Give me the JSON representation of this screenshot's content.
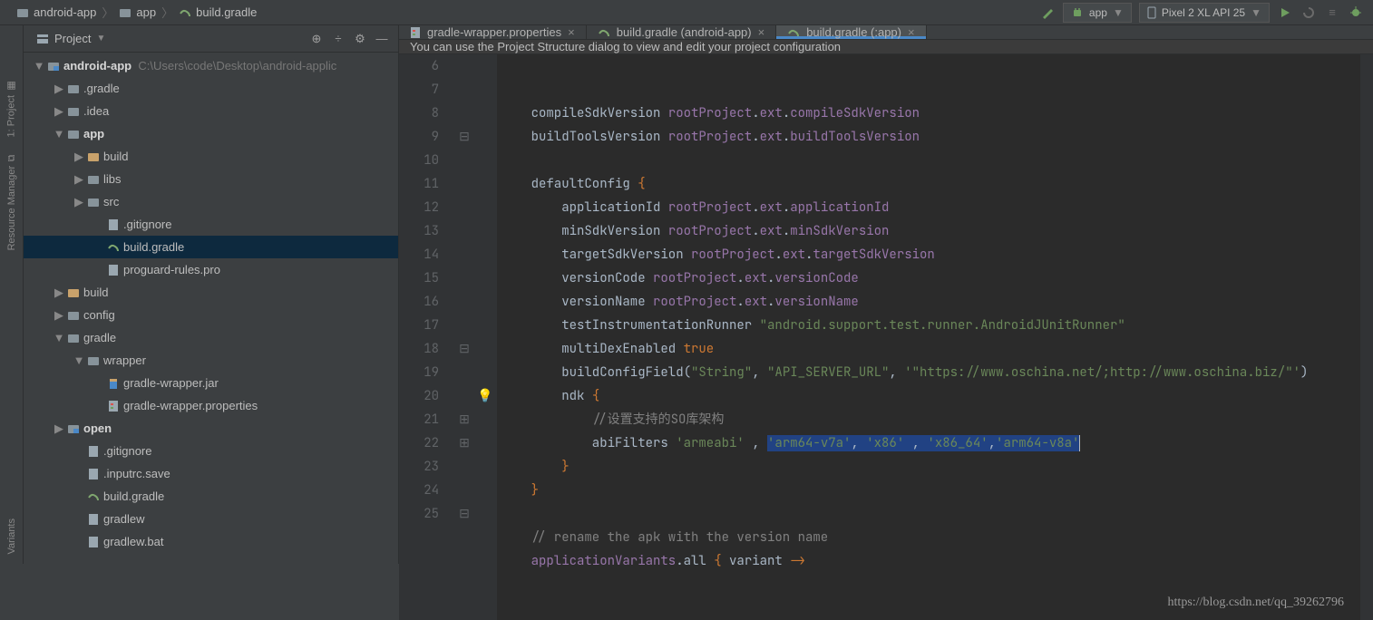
{
  "breadcrumb": {
    "items": [
      "android-app",
      "app",
      "build.gradle"
    ]
  },
  "toolbar": {
    "run_config": "app",
    "device": "Pixel 2 XL API 25"
  },
  "leftRail": {
    "tabs": [
      "1: Project",
      "Resource Manager",
      "Variants"
    ]
  },
  "projectPanel": {
    "title": "Project",
    "root": {
      "name": "android-app",
      "path": "C:\\Users\\code\\Desktop\\android-applic"
    },
    "tree": [
      {
        "indent": 1,
        "arrow": "▶",
        "icon": "folder",
        "label": ".gradle"
      },
      {
        "indent": 1,
        "arrow": "▶",
        "icon": "folder",
        "label": ".idea"
      },
      {
        "indent": 1,
        "arrow": "▼",
        "icon": "folder",
        "label": "app",
        "bold": true
      },
      {
        "indent": 2,
        "arrow": "▶",
        "icon": "folder-tan",
        "label": "build"
      },
      {
        "indent": 2,
        "arrow": "▶",
        "icon": "folder",
        "label": "libs"
      },
      {
        "indent": 2,
        "arrow": "▶",
        "icon": "folder",
        "label": "src"
      },
      {
        "indent": 3,
        "arrow": "",
        "icon": "file",
        "label": ".gitignore"
      },
      {
        "indent": 3,
        "arrow": "",
        "icon": "gradle",
        "label": "build.gradle",
        "selected": true
      },
      {
        "indent": 3,
        "arrow": "",
        "icon": "file",
        "label": "proguard-rules.pro"
      },
      {
        "indent": 1,
        "arrow": "▶",
        "icon": "folder-tan",
        "label": "build"
      },
      {
        "indent": 1,
        "arrow": "▶",
        "icon": "folder",
        "label": "config"
      },
      {
        "indent": 1,
        "arrow": "▼",
        "icon": "folder",
        "label": "gradle"
      },
      {
        "indent": 2,
        "arrow": "▼",
        "icon": "folder",
        "label": "wrapper"
      },
      {
        "indent": 3,
        "arrow": "",
        "icon": "jar",
        "label": "gradle-wrapper.jar"
      },
      {
        "indent": 3,
        "arrow": "",
        "icon": "props",
        "label": "gradle-wrapper.properties"
      },
      {
        "indent": 1,
        "arrow": "▶",
        "icon": "module",
        "label": "open",
        "bold": true
      },
      {
        "indent": 2,
        "arrow": "",
        "icon": "file",
        "label": ".gitignore"
      },
      {
        "indent": 2,
        "arrow": "",
        "icon": "file",
        "label": ".inputrc.save"
      },
      {
        "indent": 2,
        "arrow": "",
        "icon": "gradle",
        "label": "build.gradle"
      },
      {
        "indent": 2,
        "arrow": "",
        "icon": "file",
        "label": "gradlew"
      },
      {
        "indent": 2,
        "arrow": "",
        "icon": "file",
        "label": "gradlew.bat"
      }
    ]
  },
  "editor": {
    "tabs": [
      {
        "icon": "props",
        "label": "gradle-wrapper.properties",
        "active": false
      },
      {
        "icon": "gradle",
        "label": "build.gradle (android-app)",
        "active": false
      },
      {
        "icon": "gradle",
        "label": "build.gradle (:app)",
        "active": true
      }
    ],
    "infobar": "You can use the Project Structure dialog to view and edit your project configuration",
    "first_line_no": 6,
    "lines": [
      {
        "n": 6,
        "fold": "",
        "bulb": false,
        "html": "    compileSdkVersion <span class='prop'>rootProject</span>.<span class='prop'>ext</span>.<span class='prop'>compileSdkVersion</span>"
      },
      {
        "n": 7,
        "fold": "",
        "bulb": false,
        "html": "    buildToolsVersion <span class='prop'>rootProject</span>.<span class='prop'>ext</span>.<span class='prop'>buildToolsVersion</span>"
      },
      {
        "n": 8,
        "fold": "",
        "bulb": false,
        "html": ""
      },
      {
        "n": 9,
        "fold": "⊟",
        "bulb": false,
        "html": "    defaultConfig <span class='kw'>{</span>"
      },
      {
        "n": 10,
        "fold": "",
        "bulb": false,
        "html": "        applicationId <span class='prop'>rootProject</span>.<span class='prop'>ext</span>.<span class='prop'>applicationId</span>"
      },
      {
        "n": 11,
        "fold": "",
        "bulb": false,
        "html": "        minSdkVersion <span class='prop'>rootProject</span>.<span class='prop'>ext</span>.<span class='prop'>minSdkVersion</span>"
      },
      {
        "n": 12,
        "fold": "",
        "bulb": false,
        "html": "        targetSdkVersion <span class='prop'>rootProject</span>.<span class='prop'>ext</span>.<span class='prop'>targetSdkVersion</span>"
      },
      {
        "n": 13,
        "fold": "",
        "bulb": false,
        "html": "        versionCode <span class='prop'>rootProject</span>.<span class='prop'>ext</span>.<span class='prop'>versionCode</span>"
      },
      {
        "n": 14,
        "fold": "",
        "bulb": false,
        "html": "        versionName <span class='prop'>rootProject</span>.<span class='prop'>ext</span>.<span class='prop'>versionName</span>"
      },
      {
        "n": 15,
        "fold": "",
        "bulb": false,
        "html": "        testInstrumentationRunner <span class='str'>\"android.support.test.runner.AndroidJUnitRunner\"</span>"
      },
      {
        "n": 16,
        "fold": "",
        "bulb": false,
        "html": "        multiDexEnabled <span class='kw'>true</span>"
      },
      {
        "n": 17,
        "fold": "",
        "bulb": false,
        "html": "        buildConfigField(<span class='str'>\"String\"</span>, <span class='str'>\"API_SERVER_URL\"</span>, <span class='str'>'\"https://www.oschina.net/;http://www.oschina.biz/\"'</span>)"
      },
      {
        "n": 18,
        "fold": "⊟",
        "bulb": false,
        "html": "        ndk <span class='kw'>{</span>"
      },
      {
        "n": 19,
        "fold": "",
        "bulb": false,
        "html": "            <span class='cmt'>//设置支持的SO库架构</span>"
      },
      {
        "n": 20,
        "fold": "",
        "bulb": true,
        "html": "            abiFilters <span class='str'>'armeabi'</span> , <span class='sel'><span class='str'>'arm64-v7a'</span>, <span class='str'>'x86'</span> , <span class='str'>'x86_64'</span>,<span class='str'>'arm64-v8a'</span></span><span class='cursor'></span>"
      },
      {
        "n": 21,
        "fold": "⊞",
        "bulb": false,
        "html": "        <span class='kw'>}</span>"
      },
      {
        "n": 22,
        "fold": "⊞",
        "bulb": false,
        "html": "    <span class='kw'>}</span>"
      },
      {
        "n": 23,
        "fold": "",
        "bulb": false,
        "html": ""
      },
      {
        "n": 24,
        "fold": "",
        "bulb": false,
        "html": "    <span class='cmt'>// rename the apk with the version name</span>"
      },
      {
        "n": 25,
        "fold": "⊟",
        "bulb": false,
        "html": "    <span class='prop'>applicationVariants</span>.all <span class='kw'>{</span> <span class='fn'>variant</span> <span class='kw'>-&gt;</span>"
      }
    ]
  },
  "watermark": "https://blog.csdn.net/qq_39262796"
}
